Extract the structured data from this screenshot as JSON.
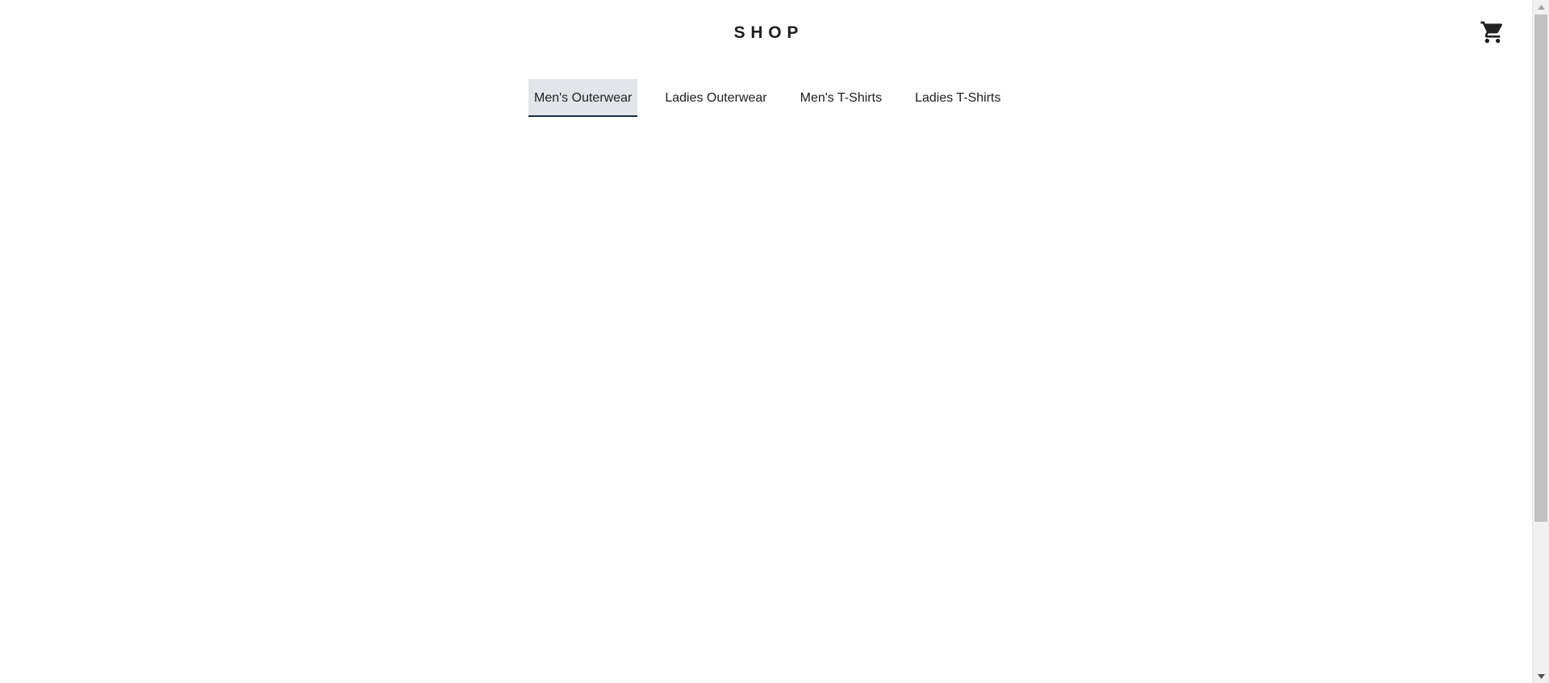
{
  "header": {
    "logo_text": "SHOP",
    "cart_icon": "shopping-cart-icon"
  },
  "nav": {
    "tabs": [
      {
        "label": "Men's Outerwear",
        "active": true
      },
      {
        "label": "Ladies Outerwear",
        "active": false
      },
      {
        "label": "Men's T-Shirts",
        "active": false
      },
      {
        "label": "Ladies T-Shirts",
        "active": false
      }
    ]
  },
  "colors": {
    "active_tab_background": "#e2e5ea",
    "active_tab_underline": "#172c50",
    "text": "#202020"
  }
}
